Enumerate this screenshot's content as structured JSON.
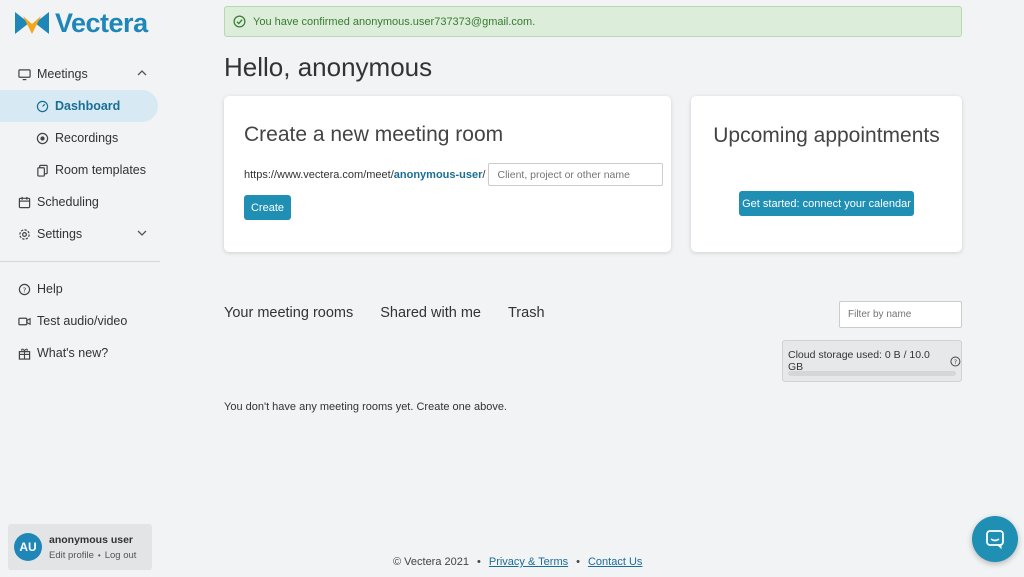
{
  "brand": {
    "name": "Vectera"
  },
  "sidebar": {
    "items": [
      {
        "label": "Meetings",
        "icon": "monitor-icon"
      },
      {
        "label": "Dashboard",
        "icon": "gauge-icon"
      },
      {
        "label": "Recordings",
        "icon": "record-icon"
      },
      {
        "label": "Room templates",
        "icon": "copy-icon"
      },
      {
        "label": "Scheduling",
        "icon": "calendar-icon"
      },
      {
        "label": "Settings",
        "icon": "gear-icon"
      },
      {
        "label": "Help",
        "icon": "help-icon"
      },
      {
        "label": "Test audio/video",
        "icon": "video-icon"
      },
      {
        "label": "What's new?",
        "icon": "gift-icon"
      }
    ],
    "user": {
      "initials": "AU",
      "name": "anonymous user",
      "edit_profile": "Edit profile",
      "separator": "•",
      "log_out": "Log out"
    }
  },
  "alert": {
    "message": "You have confirmed anonymous.user737373@gmail.com."
  },
  "greeting": "Hello, anonymous",
  "create_card": {
    "title": "Create a new meeting room",
    "url_prefix": "https://www.vectera.com/meet/",
    "slug": "anonymous-user",
    "slash": "/",
    "input_placeholder": "Client, project or other name",
    "button": "Create"
  },
  "appointments_card": {
    "title": "Upcoming appointments",
    "button": "Get started: connect your calendar"
  },
  "rooms": {
    "tabs": [
      "Your meeting rooms",
      "Shared with me",
      "Trash"
    ],
    "filter_placeholder": "Filter by name",
    "storage_label": "Cloud storage used: 0 B / 10.0 GB",
    "storage_used_fraction": 0,
    "empty_message": "You don't have any meeting rooms yet. Create one above."
  },
  "footer": {
    "copyright": "© Vectera 2021",
    "bullet": "•",
    "privacy": "Privacy & Terms",
    "contact": "Contact Us"
  },
  "colors": {
    "accent": "#1f8fb4",
    "brand": "#1f87b8",
    "alert_bg": "#dcedd9",
    "alert_text": "#3a7a34"
  }
}
